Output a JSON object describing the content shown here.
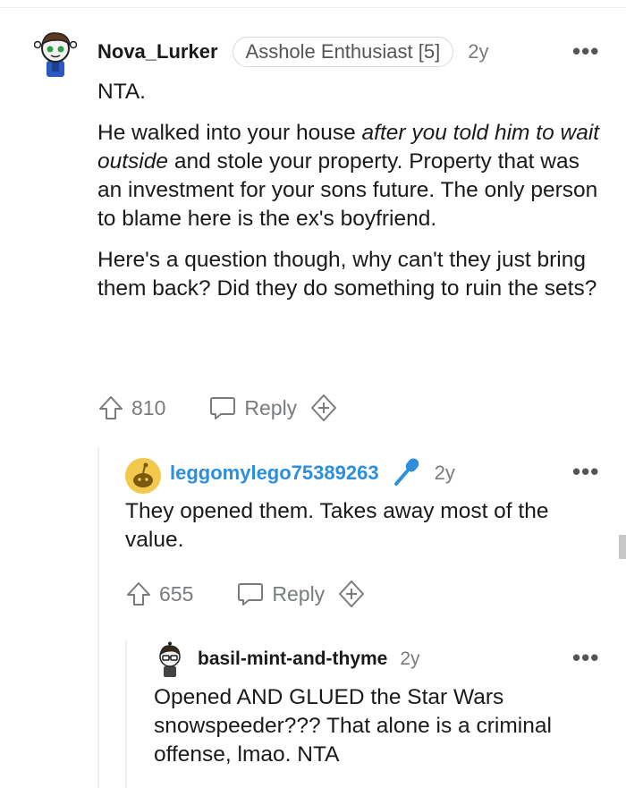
{
  "comments": [
    {
      "username": "Nova_Lurker",
      "flair": "Asshole Enthusiast [5]",
      "age": "2y",
      "paragraphs": [
        "NTA.",
        "He walked into your house after you told him to wait outside and stole your property. Property that was an investment for your sons future. The only person to blame here is the ex's boyfriend.",
        "Here's a question though, why can't they just bring them back? Did they do something to ruin the sets?"
      ],
      "p2_before": "He walked into your house ",
      "p2_em": "after you told him to wait outside",
      "p2_after": " and stole your property. Property that was an investment for your sons future. The only person to blame here is the ex's boyfriend.",
      "votes": "810",
      "reply_label": "Reply",
      "avatar_icon": "snoo-avatar-icon"
    },
    {
      "username": "leggomylego75389263",
      "badge_icon": "microphone-icon",
      "age": "2y",
      "paragraphs": [
        "They opened them. Takes away most of the value."
      ],
      "votes": "655",
      "reply_label": "Reply",
      "avatar_icon": "default-snoo-icon"
    },
    {
      "username": "basil-mint-and-thyme",
      "age": "2y",
      "paragraphs": [
        "Opened AND GLUED the Star Wars snowspeeder??? That alone is a criminal offense, lmao. NTA"
      ],
      "avatar_icon": "snoo-avatar-icon"
    }
  ],
  "icons": {
    "more": "more-options-icon",
    "upvote": "upvote-arrow-icon",
    "reply": "reply-bubble-icon",
    "award": "award-plus-icon"
  },
  "colors": {
    "text": "#1a1a1b",
    "meta": "#787c7e",
    "link_blue": "#2d8fdc",
    "badge_blue": "#2d8fdc",
    "border": "#d7dadc"
  }
}
